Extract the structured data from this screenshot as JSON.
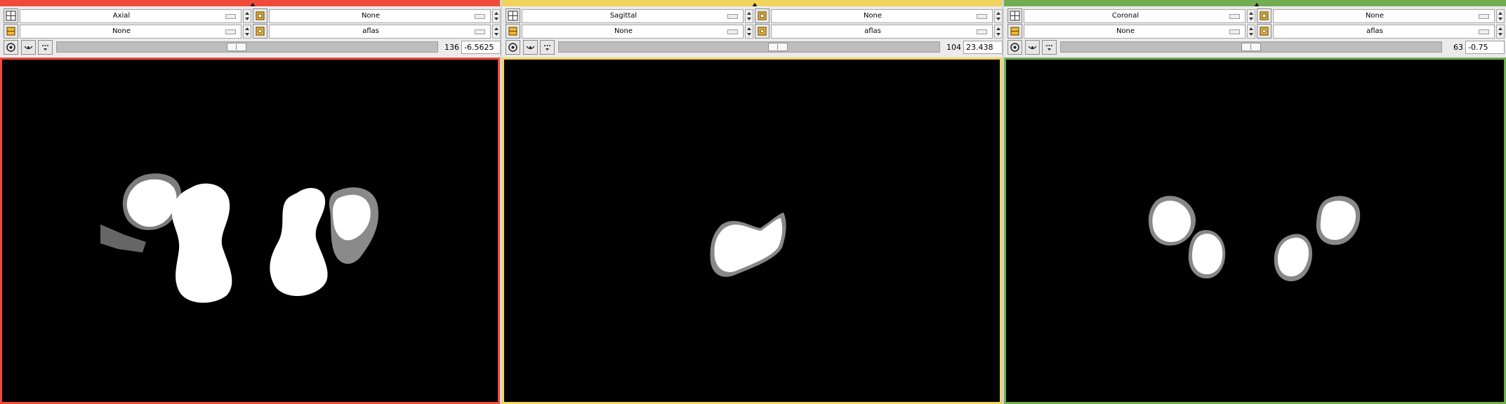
{
  "panels": [
    {
      "color": "#f04a3a",
      "orientation": "Axial",
      "foreground": "None",
      "background": "None",
      "label": "aflas",
      "slice_index": "136",
      "offset": "-6.5625",
      "slider_fraction": 0.47
    },
    {
      "color": "#f2d35c",
      "orientation": "Sagittal",
      "foreground": "None",
      "background": "None",
      "label": "aflas",
      "slice_index": "104",
      "offset": "23.438",
      "slider_fraction": 0.58
    },
    {
      "color": "#72ad52",
      "orientation": "Coronal",
      "foreground": "None",
      "background": "None",
      "label": "aflas",
      "slice_index": "63",
      "offset": "-0.75",
      "slider_fraction": 0.5
    }
  ],
  "icons": {
    "layout": "slice-layout-icon",
    "layers": "layers-icon",
    "fg_toggle": "foreground-visibility-icon",
    "label_toggle": "label-visibility-icon",
    "link": "link-icon",
    "eye": "eye-visibility-icon",
    "options": "view-options-icon"
  }
}
